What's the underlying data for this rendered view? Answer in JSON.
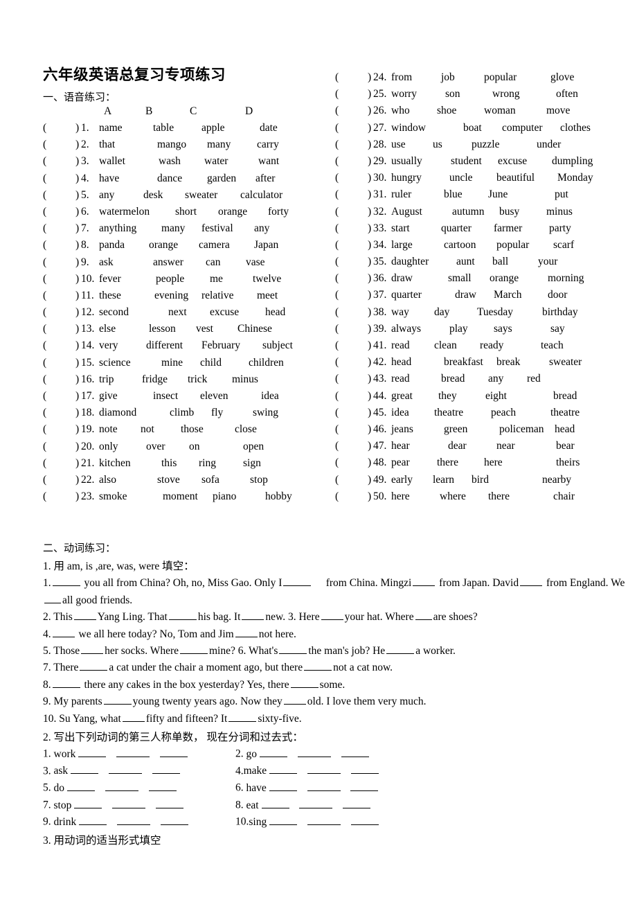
{
  "document": {
    "title": "六年级英语总复习专项练习",
    "section1_heading": "一、语音练习：",
    "section2_heading": "二、动词练习：",
    "column_headers": {
      "a": "A",
      "b": "B",
      "c": "C",
      "d": "D"
    },
    "paren_open": "(",
    "paren_close": ")"
  },
  "phonetics": {
    "left_column": [
      {
        "num": "1.",
        "options": [
          "name",
          "table",
          "apple",
          "date"
        ]
      },
      {
        "num": "2.",
        "options": [
          "that",
          "mango",
          "many",
          "carry"
        ]
      },
      {
        "num": "3.",
        "options": [
          "wallet",
          "wash",
          "water",
          "want"
        ]
      },
      {
        "num": "4.",
        "options": [
          "have",
          "dance",
          "garden",
          "after"
        ]
      },
      {
        "num": "5.",
        "options": [
          "any",
          "desk",
          "sweater",
          "calculator"
        ]
      },
      {
        "num": "6.",
        "options": [
          "watermelon",
          "short",
          "orange",
          "forty"
        ]
      },
      {
        "num": "7.",
        "options": [
          "anything",
          "many",
          "festival",
          "any"
        ]
      },
      {
        "num": "8.",
        "options": [
          "panda",
          "orange",
          "camera",
          "Japan"
        ]
      },
      {
        "num": "9.",
        "options": [
          "ask",
          "answer",
          "can",
          "vase"
        ]
      },
      {
        "num": "10.",
        "options": [
          "fever",
          "people",
          "me",
          "twelve"
        ]
      },
      {
        "num": "11.",
        "options": [
          "these",
          "evening",
          "relative",
          "meet"
        ]
      },
      {
        "num": "12.",
        "options": [
          "second",
          "next",
          "excuse",
          "head"
        ]
      },
      {
        "num": "13.",
        "options": [
          "else",
          "lesson",
          "vest",
          "Chinese"
        ]
      },
      {
        "num": "14.",
        "options": [
          "very",
          "different",
          "February",
          "subject"
        ]
      },
      {
        "num": "15.",
        "options": [
          "science",
          "mine",
          "child",
          "children"
        ]
      },
      {
        "num": "16.",
        "options": [
          "trip",
          "fridge",
          "trick",
          "minus"
        ]
      },
      {
        "num": "17.",
        "options": [
          "give",
          "insect",
          "eleven",
          "idea"
        ]
      },
      {
        "num": "18.",
        "options": [
          "diamond",
          "climb",
          "fly",
          "swing"
        ]
      },
      {
        "num": "19.",
        "options": [
          "note",
          "not",
          "those",
          "close"
        ]
      },
      {
        "num": "20.",
        "options": [
          "only",
          "over",
          "on",
          "open"
        ]
      },
      {
        "num": "21.",
        "options": [
          "kitchen",
          "this",
          "ring",
          "sign"
        ]
      },
      {
        "num": "22.",
        "options": [
          "also",
          "stove",
          "sofa",
          "stop"
        ]
      },
      {
        "num": "23.",
        "options": [
          "smoke",
          "moment",
          "piano",
          "hobby"
        ]
      }
    ],
    "right_column": [
      {
        "num": "24.",
        "options": [
          "from",
          "job",
          "popular",
          "glove"
        ]
      },
      {
        "num": "25.",
        "options": [
          "worry",
          "son",
          "wrong",
          "often"
        ]
      },
      {
        "num": "26.",
        "options": [
          "who",
          "shoe",
          "woman",
          "move"
        ]
      },
      {
        "num": "27.",
        "options": [
          "window",
          "boat",
          "computer",
          "clothes"
        ]
      },
      {
        "num": "28.",
        "options": [
          "use",
          "us",
          "puzzle",
          "under"
        ]
      },
      {
        "num": "29.",
        "options": [
          "usually",
          "student",
          "excuse",
          "dumpling"
        ]
      },
      {
        "num": "30.",
        "options": [
          "hungry",
          "uncle",
          "beautiful",
          "Monday"
        ]
      },
      {
        "num": "31.",
        "options": [
          "ruler",
          "blue",
          "June",
          "put"
        ]
      },
      {
        "num": "32.",
        "options": [
          "August",
          "autumn",
          "busy",
          "minus"
        ]
      },
      {
        "num": "33.",
        "options": [
          "start",
          "quarter",
          "farmer",
          "party"
        ]
      },
      {
        "num": "34.",
        "options": [
          "large",
          "cartoon",
          "popular",
          "scarf"
        ]
      },
      {
        "num": "35.",
        "options": [
          "daughter",
          "aunt",
          "ball",
          "your"
        ]
      },
      {
        "num": "36.",
        "options": [
          "draw",
          "small",
          "orange",
          "morning"
        ]
      },
      {
        "num": "37.",
        "options": [
          "quarter",
          "draw",
          "March",
          "door"
        ]
      },
      {
        "num": "38.",
        "options": [
          "way",
          "day",
          "Tuesday",
          "birthday"
        ]
      },
      {
        "num": "39.",
        "options": [
          "always",
          "play",
          "says",
          "say"
        ]
      },
      {
        "num": "41.",
        "options": [
          "read",
          "clean",
          "ready",
          "teach"
        ]
      },
      {
        "num": "42.",
        "options": [
          "head",
          "breakfast",
          "break",
          "sweater"
        ]
      },
      {
        "num": "43.",
        "options": [
          "read",
          "bread",
          "any",
          "red"
        ]
      },
      {
        "num": "44.",
        "options": [
          "great",
          "they",
          "eight",
          "bread"
        ]
      },
      {
        "num": "45.",
        "options": [
          "idea",
          "theatre",
          "peach",
          "theatre"
        ]
      },
      {
        "num": "46.",
        "options": [
          "jeans",
          "green",
          "policeman",
          "head"
        ]
      },
      {
        "num": "47.",
        "options": [
          "hear",
          "dear",
          "near",
          "bear"
        ]
      },
      {
        "num": "48.",
        "options": [
          "pear",
          "there",
          "here",
          "theirs"
        ]
      },
      {
        "num": "49.",
        "options": [
          "early",
          "learn",
          "bird",
          "nearby"
        ]
      },
      {
        "num": "50.",
        "options": [
          "here",
          "where",
          "there",
          "chair"
        ]
      }
    ]
  },
  "verbs": {
    "task1_heading": "1. 用 am, is ,are, was, were  填空：",
    "task1_items": {
      "q1_a": "1.",
      "q1_b": "you all from China? Oh, no, Miss Gao. Only I",
      "q1_c": "from China. Mingzi",
      "q1_d": "from Japan. David",
      "q1_e": "from England. We",
      "q1_f": "all good friends.",
      "q2_a": "2. This",
      "q2_b": "Yang Ling. That",
      "q2_c": "his bag. It",
      "q2_d": "new. 3. Here",
      "q2_e": "your hat. Where",
      "q2_f": "are shoes?",
      "q4_a": "4.",
      "q4_b": "we all here today? No, Tom and Jim",
      "q4_c": "not here.",
      "q5_a": "5. Those",
      "q5_b": "her socks. Where",
      "q5_c": "mine? 6. What's",
      "q5_d": "the man's job? He",
      "q5_e": "a worker.",
      "q7_a": "7. There",
      "q7_b": "a cat under the chair a moment ago, but there",
      "q7_c": "not a cat now.",
      "q8_a": "8.",
      "q8_b": "there any cakes in the box yesterday? Yes, there",
      "q8_c": "some.",
      "q9_a": "9. My parents",
      "q9_b": "young twenty years ago. Now they",
      "q9_c": "old. I love them very much.",
      "q10_a": "10. Su Yang, what",
      "q10_b": "fifty and fifteen? It",
      "q10_c": "sixty-five."
    },
    "task2_heading": "2. 写出下列动词的第三人称单数，  现在分词和过去式：",
    "task2_items": [
      {
        "num": "1.",
        "verb": "work"
      },
      {
        "num": "2.",
        "verb": "go"
      },
      {
        "num": "3.",
        "verb": "ask"
      },
      {
        "num": "4.",
        "verb": "make"
      },
      {
        "num": "5.",
        "verb": "do"
      },
      {
        "num": "6.",
        "verb": "have"
      },
      {
        "num": "7.",
        "verb": "stop"
      },
      {
        "num": "8.",
        "verb": "eat"
      },
      {
        "num": "9.",
        "verb": "drink"
      },
      {
        "num": "10.",
        "verb": "sing"
      }
    ],
    "task3_heading": "3. 用动词的适当形式填空"
  }
}
